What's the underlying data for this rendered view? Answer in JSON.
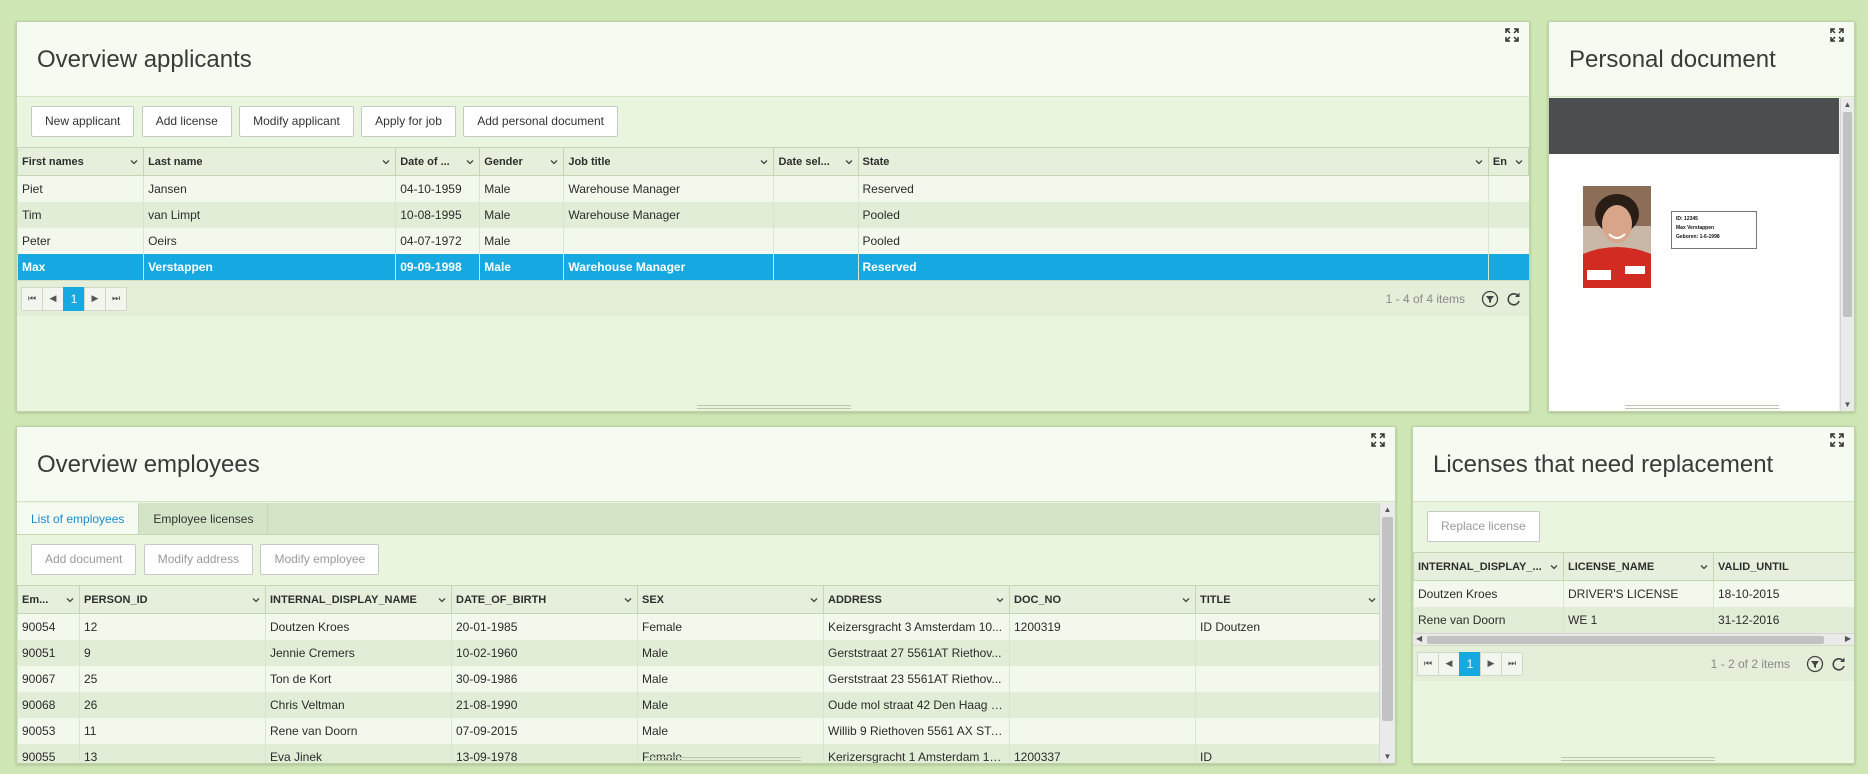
{
  "applicants": {
    "title": "Overview applicants",
    "buttons": [
      "New applicant",
      "Add license",
      "Modify applicant",
      "Apply for job",
      "Add personal document"
    ],
    "columns": [
      "First names",
      "Last name",
      "Date of ...",
      "Gender",
      "Job title",
      "Date sel...",
      "State",
      "En"
    ],
    "rows": [
      [
        "Piet",
        "Jansen",
        "04-10-1959",
        "Male",
        "Warehouse Manager",
        "",
        "Reserved",
        ""
      ],
      [
        "Tim",
        "van Limpt",
        "10-08-1995",
        "Male",
        "Warehouse Manager",
        "",
        "Pooled",
        ""
      ],
      [
        "Peter",
        "Oeirs",
        "04-07-1972",
        "Male",
        "",
        "",
        "Pooled",
        ""
      ],
      [
        "Max",
        "Verstappen",
        "09-09-1998",
        "Male",
        "Warehouse Manager",
        "",
        "Reserved",
        ""
      ]
    ],
    "selected_row": 3,
    "pager": {
      "page": "1",
      "info": "1 - 4 of 4 items"
    }
  },
  "document": {
    "title": "Personal document",
    "card_lines": [
      "ID: 12345",
      "Max Verstappen",
      "Geboren: 1-6-1998"
    ]
  },
  "employees": {
    "title": "Overview employees",
    "tabs": [
      "List of employees",
      "Employee licenses"
    ],
    "buttons": [
      "Add document",
      "Modify address",
      "Modify employee"
    ],
    "columns": [
      "Em...",
      "PERSON_ID",
      "INTERNAL_DISPLAY_NAME",
      "DATE_OF_BIRTH",
      "SEX",
      "ADDRESS",
      "DOC_NO",
      "TITLE"
    ],
    "rows": [
      [
        "90054",
        "12",
        "Doutzen Kroes",
        "20-01-1985",
        "Female",
        "Keizersgracht 3 Amsterdam 10...",
        "1200319",
        "ID Doutzen"
      ],
      [
        "90051",
        "9",
        "Jennie Cremers",
        "10-02-1960",
        "Male",
        "Gerststraat 27  5561AT Riethov...",
        "",
        ""
      ],
      [
        "90067",
        "25",
        "Ton de Kort",
        "30-09-1986",
        "Male",
        "Gerststraat 23  5561AT Riethov...",
        "",
        ""
      ],
      [
        "90068",
        "26",
        "Chris Veltman",
        "21-08-1990",
        "Male",
        "Oude mol straat 42  Den Haag 2...",
        "",
        ""
      ],
      [
        "90053",
        "11",
        "Rene van Doorn",
        "07-09-2015",
        "Male",
        "Willib 9 Riethoven 5561 AX STA...",
        "",
        ""
      ],
      [
        "90055",
        "13",
        "Eva Jinek",
        "13-09-1978",
        "Female",
        "Kerizersgracht 1 Amsterdam 10...",
        "1200337",
        "ID"
      ]
    ]
  },
  "licenses": {
    "title": "Licenses that need replacement",
    "button": "Replace license",
    "columns": [
      "INTERNAL_DISPLAY_...",
      "LICENSE_NAME",
      "VALID_UNTIL"
    ],
    "rows": [
      [
        "Doutzen Kroes",
        "DRIVER'S LICENSE",
        "18-10-2015"
      ],
      [
        "Rene van Doorn",
        "WE 1",
        "31-12-2016"
      ]
    ],
    "pager": {
      "page": "1",
      "info": "1 - 2 of 2 items"
    }
  },
  "colors": {
    "accent": "#16a9e1",
    "background": "#cfe6b5",
    "panel": "#eaf5df"
  }
}
